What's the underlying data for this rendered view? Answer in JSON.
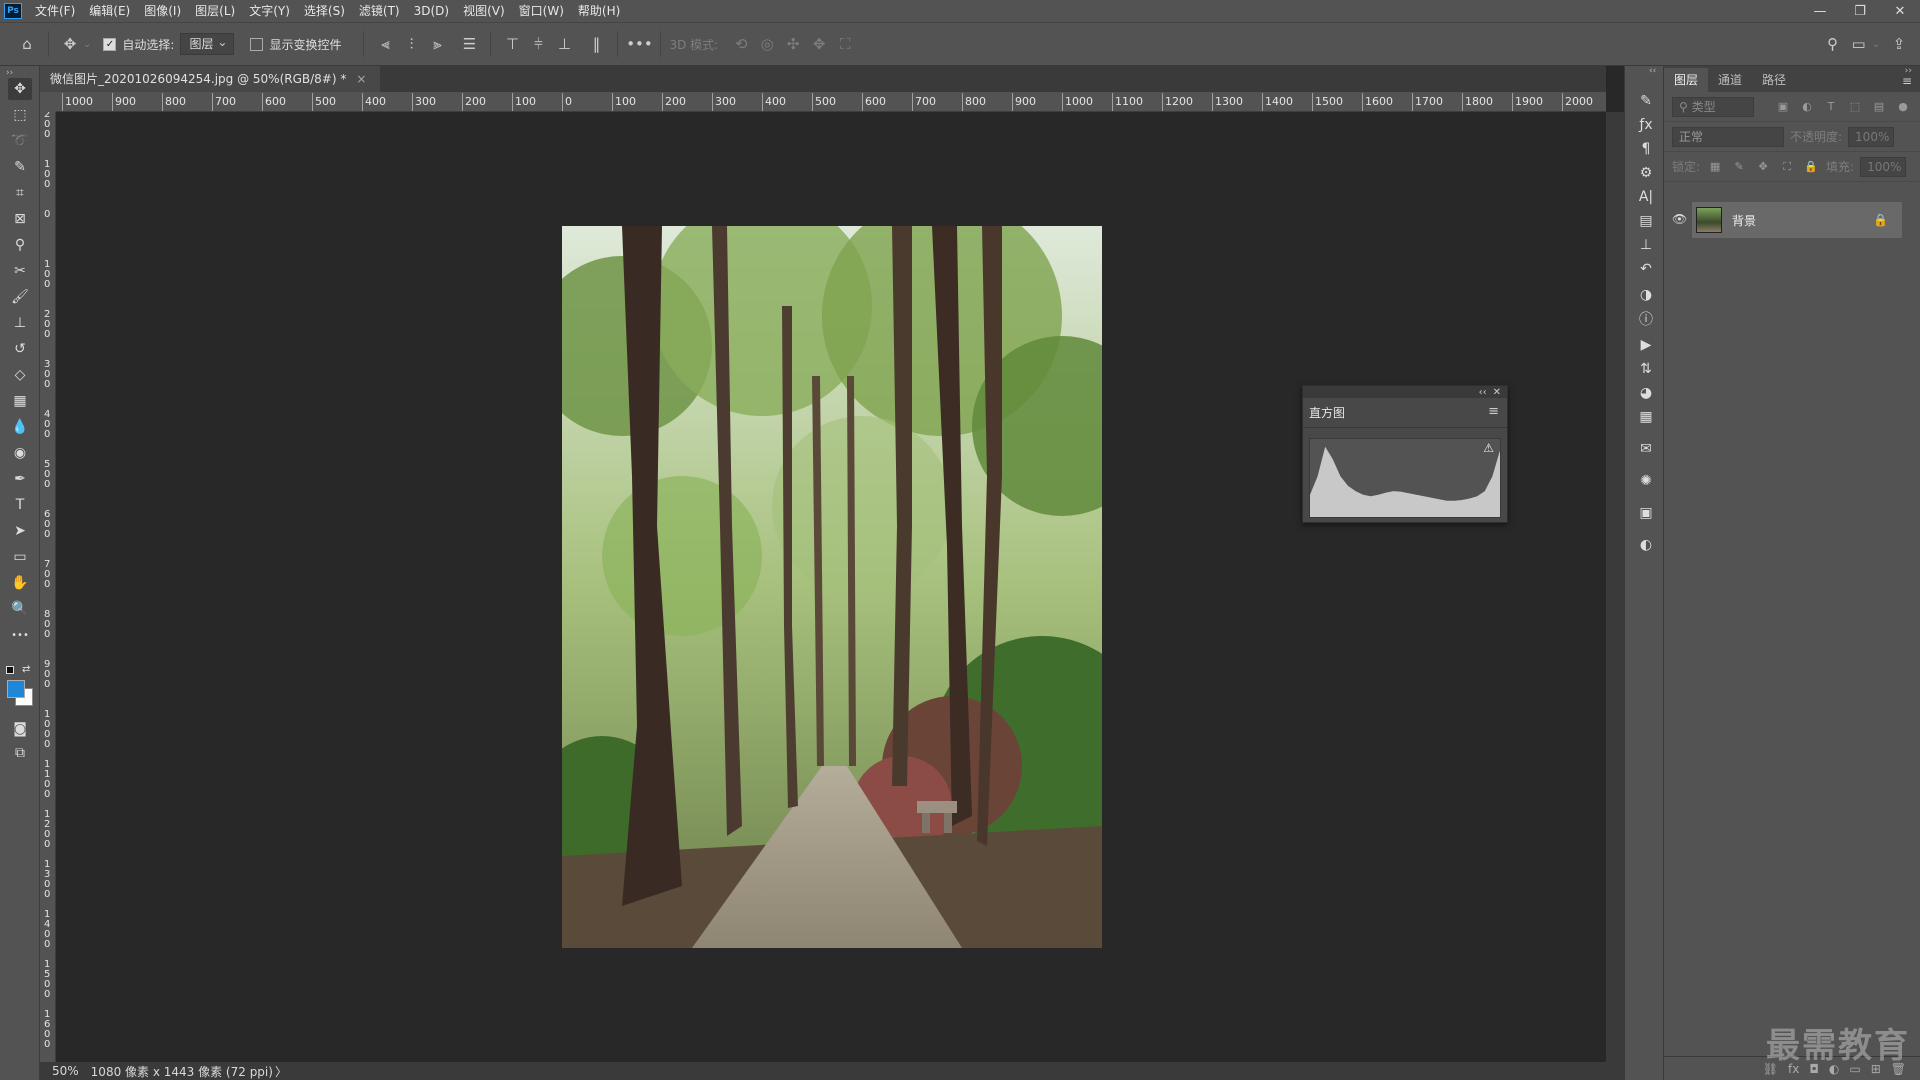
{
  "app": {
    "logo_text": "Ps"
  },
  "menu": {
    "items": [
      "文件(F)",
      "编辑(E)",
      "图像(I)",
      "图层(L)",
      "文字(Y)",
      "选择(S)",
      "滤镜(T)",
      "3D(D)",
      "视图(V)",
      "窗口(W)",
      "帮助(H)"
    ]
  },
  "window_controls": {
    "minimize": "—",
    "restore": "❐",
    "close": "✕"
  },
  "options": {
    "auto_select_label": "自动选择:",
    "auto_select_checked": true,
    "target_select_value": "图层",
    "show_transform_label": "显示变换控件",
    "show_transform_checked": false,
    "more_label": "•••",
    "mode_3d_label": "3D 模式:"
  },
  "document": {
    "tab_title": "微信图片_20201026094254.jpg @ 50%(RGB/8#) *",
    "tab_close": "×"
  },
  "rulers": {
    "horizontal_labels": [
      "1000",
      "900",
      "800",
      "700",
      "600",
      "500",
      "400",
      "300",
      "200",
      "100",
      "0",
      "100",
      "200",
      "300",
      "400",
      "500",
      "600",
      "700",
      "800",
      "900",
      "1000",
      "1100",
      "1200",
      "1300",
      "1400",
      "1500",
      "1600",
      "1700",
      "1800",
      "1900",
      "2000"
    ],
    "vertical_labels": [
      "200",
      "100",
      "0",
      "100",
      "200",
      "300",
      "400",
      "500",
      "600",
      "700",
      "800",
      "900",
      "1000",
      "1100",
      "1200",
      "1300",
      "1400",
      "1500",
      "1600"
    ]
  },
  "status": {
    "zoom": "50%",
    "doc_info": "1080 像素 x 1443 像素 (72 ppi)",
    "arrow": "〉"
  },
  "histogram_panel": {
    "title": "直方图",
    "collapse": "‹‹",
    "close": "✕",
    "menu": "≡",
    "warning": "⚠",
    "curve": [
      0.3,
      0.55,
      0.95,
      0.78,
      0.55,
      0.42,
      0.35,
      0.3,
      0.28,
      0.3,
      0.33,
      0.35,
      0.34,
      0.32,
      0.3,
      0.28,
      0.26,
      0.24,
      0.22,
      0.22,
      0.23,
      0.25,
      0.28,
      0.35,
      0.55,
      0.9
    ]
  },
  "layers_panel": {
    "tabs": [
      "图层",
      "通道",
      "路径"
    ],
    "active_tab": 0,
    "filter_placeholder": "类型",
    "blend_mode": "正常",
    "opacity_label": "不透明度:",
    "opacity_value": "100%",
    "lock_label": "锁定:",
    "fill_label": "填充:",
    "fill_value": "100%",
    "layers": [
      {
        "name": "背景",
        "visible": true,
        "locked": true
      }
    ],
    "bottom_icons": [
      "link-icon",
      "fx-icon",
      "mask-icon",
      "adjustment-icon",
      "group-icon",
      "new-layer-icon",
      "delete-icon"
    ],
    "bottom_glyphs": [
      "⛓",
      "fx",
      "◘",
      "◐",
      "▭",
      "⊞",
      "🗑"
    ]
  },
  "tools": [
    {
      "name": "move-tool-icon",
      "glyph": "✥"
    },
    {
      "name": "marquee-tool-icon",
      "glyph": "⬚"
    },
    {
      "name": "lasso-tool-icon",
      "glyph": "➰"
    },
    {
      "name": "quick-select-tool-icon",
      "glyph": "✎"
    },
    {
      "name": "crop-tool-icon",
      "glyph": "⌗"
    },
    {
      "name": "frame-tool-icon",
      "glyph": "⊠"
    },
    {
      "name": "eyedropper-tool-icon",
      "glyph": "⚲"
    },
    {
      "name": "healing-tool-icon",
      "glyph": "✂"
    },
    {
      "name": "brush-tool-icon",
      "glyph": "🖌"
    },
    {
      "name": "stamp-tool-icon",
      "glyph": "⊥"
    },
    {
      "name": "history-brush-tool-icon",
      "glyph": "↺"
    },
    {
      "name": "eraser-tool-icon",
      "glyph": "◇"
    },
    {
      "name": "gradient-tool-icon",
      "glyph": "▦"
    },
    {
      "name": "blur-tool-icon",
      "glyph": "💧"
    },
    {
      "name": "dodge-tool-icon",
      "glyph": "◉"
    },
    {
      "name": "pen-tool-icon",
      "glyph": "✒"
    },
    {
      "name": "type-tool-icon",
      "glyph": "T"
    },
    {
      "name": "path-select-tool-icon",
      "glyph": "➤"
    },
    {
      "name": "shape-tool-icon",
      "glyph": "▭"
    },
    {
      "name": "hand-tool-icon",
      "glyph": "✋"
    },
    {
      "name": "zoom-tool-icon",
      "glyph": "🔍"
    },
    {
      "name": "more-tools-icon",
      "glyph": "•••"
    }
  ],
  "colors": {
    "foreground": "#1e88d6",
    "background": "#ffffff",
    "accent": "#2fa3f7"
  },
  "dock_icons": [
    "brush-settings-icon",
    "styles-icon",
    "paragraph-icon",
    "properties-icon",
    "character-icon",
    "libraries-icon",
    "clone-source-icon",
    "history-icon",
    "adjustments-icon",
    "info-icon",
    "actions-icon",
    "swatches-icon",
    "channels-3d-icon",
    "table-icon",
    "notes-icon",
    "navigator-icon",
    "timeline-icon",
    "color-icon"
  ],
  "dock_glyphs": [
    "✎",
    "ƒx",
    "¶",
    "⚙",
    "A|",
    "▤",
    "⊥",
    "↶",
    "◑",
    "ⓘ",
    "▶",
    "⇅",
    "◕",
    "▦",
    "✉",
    "✺",
    "▣",
    "◐"
  ],
  "watermark": "最需教育"
}
